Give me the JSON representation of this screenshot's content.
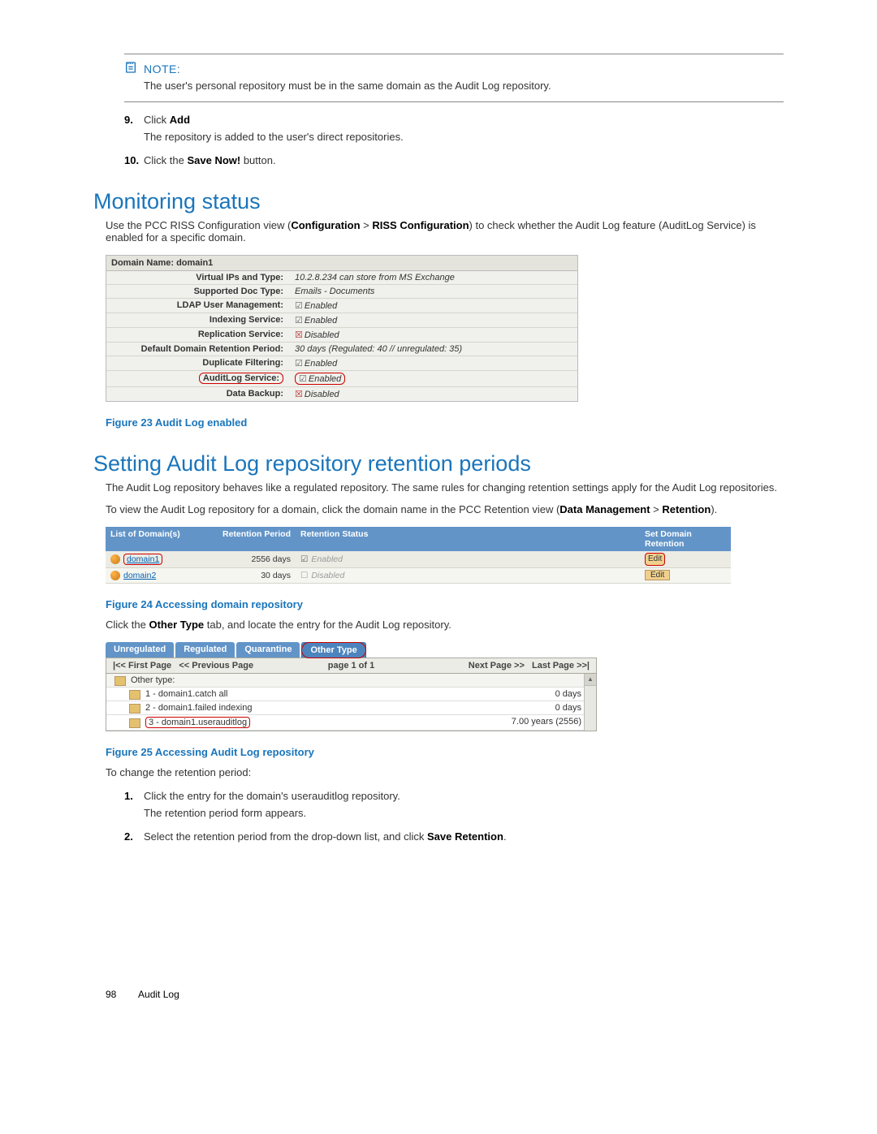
{
  "note": {
    "label": "NOTE:",
    "text": "The user's personal repository must be in the same domain as the Audit Log repository."
  },
  "steps": {
    "s9": {
      "num": "9.",
      "pre": "Click ",
      "bold": "Add"
    },
    "s9sub": "The repository is added to the user's direct repositories.",
    "s10": {
      "num": "10.",
      "pre": "Click the ",
      "bold": "Save Now!",
      "post": " button."
    }
  },
  "heading1": "Monitoring status",
  "h1body": {
    "pre": "Use the PCC RISS Configuration view (",
    "b1": "Configuration",
    "gt1": " > ",
    "b2": "RISS Configuration",
    "post": ") to check whether the Audit Log feature (AuditLog Service) is enabled for a specific domain."
  },
  "cfg": {
    "header": "Domain Name: domain1",
    "rows": [
      {
        "l": "Virtual IPs and Type:",
        "v": "10.2.8.234 can store from MS Exchange"
      },
      {
        "l": "Supported Doc Type:",
        "v": "Emails -   Documents"
      },
      {
        "l": "LDAP User Management:",
        "v": "Enabled",
        "c": "chk"
      },
      {
        "l": "Indexing Service:",
        "v": "Enabled",
        "c": "chk"
      },
      {
        "l": "Replication Service:",
        "v": "Disabled",
        "c": "dis"
      },
      {
        "l": "Default Domain Retention Period:",
        "v": "30 days (Regulated: 40 // unregulated: 35)"
      },
      {
        "l": "Duplicate Filtering:",
        "v": "Enabled",
        "c": "chk"
      },
      {
        "l": "AuditLog Service:",
        "v": "Enabled",
        "c": "chk",
        "hl": true
      },
      {
        "l": "Data Backup:",
        "v": "Disabled",
        "c": "dis"
      }
    ]
  },
  "fig23": "Figure 23 Audit Log enabled",
  "heading2": "Setting Audit Log repository retention periods",
  "h2body1": "The Audit Log repository behaves like a regulated repository. The same rules for changing retention settings apply for the Audit Log repositories.",
  "h2body2": {
    "pre": "To view the Audit Log repository for a domain, click the domain name in the PCC Retention view (",
    "b1": "Data Management",
    "gt": " > ",
    "b2": "Retention",
    "post": ")."
  },
  "dom": {
    "h": {
      "c1": "List of Domain(s)",
      "c2": "Retention Period",
      "c3": "Retention Status",
      "c4": "Set Domain Retention"
    },
    "r1": {
      "name": "domain1",
      "period": "2556 days",
      "status": "Enabled",
      "edit": "Edit"
    },
    "r2": {
      "name": "domain2",
      "period": "30 days",
      "status": "Disabled",
      "edit": "Edit"
    }
  },
  "fig24": "Figure 24 Accessing domain repository",
  "afterfig24": {
    "pre": "Click the ",
    "b": "Other Type",
    "post": " tab, and locate the entry for the Audit Log repository."
  },
  "rep": {
    "tabs": [
      "Unregulated",
      "Regulated",
      "Quarantine",
      "Other Type"
    ],
    "pager": {
      "first": "|<< First Page",
      "prev": "<< Previous Page",
      "mid": "page 1 of 1",
      "next": "Next Page >>",
      "last": "Last Page >>|"
    },
    "rows": [
      {
        "l": "Other type:",
        "v": ""
      },
      {
        "l": "1 - domain1.catch all",
        "v": "0 days"
      },
      {
        "l": "2 - domain1.failed indexing",
        "v": "0 days"
      },
      {
        "l": "3 - domain1.userauditlog",
        "v": "7.00 years (2556)",
        "hl": true
      }
    ]
  },
  "fig25": "Figure 25 Accessing Audit Log repository",
  "afterfig25": "To change the retention period:",
  "steps2": {
    "s1": {
      "num": "1.",
      "txt": "Click the entry for the domain's userauditlog repository."
    },
    "s1sub": "The retention period form appears.",
    "s2": {
      "num": "2.",
      "pre": "Select the retention period from the drop-down list, and click ",
      "b": "Save Retention",
      "post": "."
    }
  },
  "footer": {
    "page": "98",
    "title": "Audit Log"
  }
}
